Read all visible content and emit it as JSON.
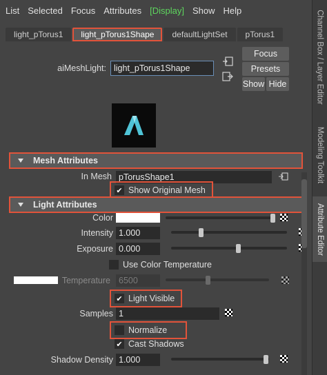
{
  "menubar": {
    "items": [
      "List",
      "Selected",
      "Focus",
      "Attributes",
      "[Display]",
      "Show",
      "Help"
    ]
  },
  "tabs": [
    "light_pTorus1",
    "light_pTorus1Shape",
    "defaultLightSet",
    "pTorus1"
  ],
  "node": {
    "label": "aiMeshLight:",
    "value": "light_pTorus1Shape"
  },
  "buttons": {
    "focus": "Focus",
    "presets": "Presets",
    "show": "Show",
    "hide": "Hide"
  },
  "right_tabs": {
    "channel_box": "Channel Box / Layer Editor",
    "modeling_toolkit": "Modeling Toolkit",
    "attribute_editor": "Attribute Editor"
  },
  "mesh_attributes": {
    "title": "Mesh Attributes",
    "in_mesh_label": "In Mesh",
    "in_mesh_value": "pTorusShape1",
    "show_original_mesh": "Show Original Mesh",
    "show_original_mesh_checked": true
  },
  "light_attributes": {
    "title": "Light Attributes",
    "color_label": "Color",
    "color_value": "#ffffff",
    "intensity_label": "Intensity",
    "intensity_value": "1.000",
    "intensity_slider": 0.12,
    "exposure_label": "Exposure",
    "exposure_value": "0.000",
    "exposure_slider": 0.5,
    "use_color_temperature": "Use Color Temperature",
    "use_color_temperature_checked": false,
    "temperature_label": "Temperature",
    "temperature_value": "6500",
    "temperature_slider": 0.55,
    "light_visible": "Light Visible",
    "light_visible_checked": true,
    "samples_label": "Samples",
    "samples_value": "1",
    "normalize": "Normalize",
    "normalize_checked": false,
    "cast_shadows": "Cast Shadows",
    "cast_shadows_checked": true,
    "shadow_density_label": "Shadow Density",
    "shadow_density_value": "1.000",
    "shadow_density_slider": 1.0
  },
  "colors": {
    "accent_highlight": "#e2533a",
    "display_menu": "#5ed65e",
    "light_icon": "#4fc3d6"
  }
}
